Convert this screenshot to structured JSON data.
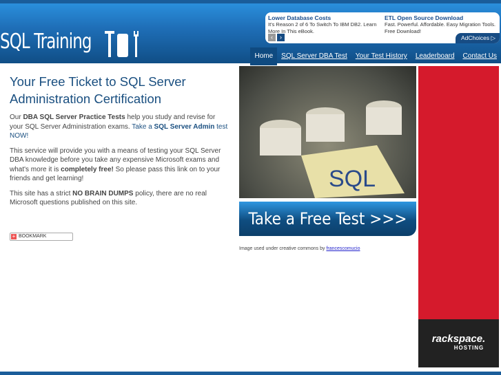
{
  "site": {
    "logo": "SQL Training"
  },
  "ads": {
    "items": [
      {
        "title": "Lower Database Costs",
        "text": "It's Reason 2 of 6 To Switch To IBM DB2. Learn More In This eBook."
      },
      {
        "title": "ETL Open Source Download",
        "text": "Fast. Powerful. Affordable. Easy Migration Tools. Free Download!"
      }
    ],
    "prev": "‹",
    "next": "›",
    "adchoices": "AdChoices ▷"
  },
  "nav": [
    "Home",
    "SQL Server DBA Test",
    "Your Test History",
    "Leaderboard",
    "Contact Us"
  ],
  "main": {
    "title": "Your Free Ticket to SQL Server Administration Certification",
    "p1_pre": "Our ",
    "p1_bold": "DBA SQL Server Practice Tests",
    "p1_mid": " help you study and revise for your SQL Server Administration exams. ",
    "p1_link_pre": "Take a ",
    "p1_link_bold": "SQL Server Admin",
    "p1_link_post": " test NOW!",
    "p2_pre": "This service will provide you with a means of testing your SQL Server DBA knowledge before you take any expensive Microsoft exams and what's more it is ",
    "p2_bold": "completely free!",
    "p2_post": " So please pass this link on to your friends and get learning!",
    "p3_pre": "This site has a strict ",
    "p3_bold": "NO BRAIN DUMPS",
    "p3_post": " policy, there are no real Microsoft questions published on this site.",
    "bookmark": "BOOKMARK"
  },
  "cta": "Take a Free Test >>>",
  "credit": {
    "text": "Image used under creative commons by ",
    "link": "francescomucio"
  },
  "sidead": {
    "brand": "rackspace.",
    "sub": "HOSTING"
  },
  "colors": {
    "header": "#1f6fb8",
    "accent": "#1a4f80",
    "ad_red": "#d51a2c"
  }
}
